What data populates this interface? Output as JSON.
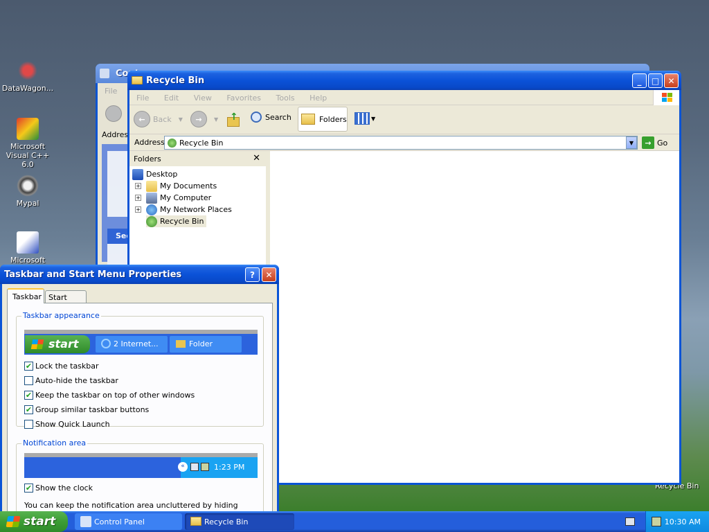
{
  "desktop": {
    "icons": [
      {
        "label": "DataWagon..."
      },
      {
        "label": "Microsoft Visual C++ 6.0"
      },
      {
        "label": "Mypal"
      },
      {
        "label": "Microsoft Visual"
      }
    ],
    "recycle_bin_label": "Recycle Bin"
  },
  "control_panel_window": {
    "title": "Cont",
    "menu_first": "File",
    "address_label": "Address",
    "section_label": "See"
  },
  "recycle_window": {
    "title": "Recycle Bin",
    "menu": [
      "File",
      "Edit",
      "View",
      "Favorites",
      "Tools",
      "Help"
    ],
    "toolbar": {
      "back": "Back",
      "search": "Search",
      "folders": "Folders"
    },
    "address_label": "Address",
    "address_value": "Recycle Bin",
    "go_label": "Go",
    "folders_pane_title": "Folders",
    "tree": [
      {
        "label": "Desktop"
      },
      {
        "label": "My Documents"
      },
      {
        "label": "My Computer"
      },
      {
        "label": "My Network Places"
      },
      {
        "label": "Recycle Bin"
      }
    ]
  },
  "taskbar_dialog": {
    "title": "Taskbar and Start Menu Properties",
    "help_btn": "?",
    "tabs": [
      "Taskbar",
      "Start Menu"
    ],
    "appearance_label": "Taskbar appearance",
    "preview": {
      "start": "start",
      "ie_item": "2 Internet...",
      "folder_item": "Folder"
    },
    "options": [
      {
        "label": "Lock the taskbar",
        "checked": true
      },
      {
        "label": "Auto-hide the taskbar",
        "checked": false
      },
      {
        "label": "Keep the taskbar on top of other windows",
        "checked": true
      },
      {
        "label": "Group similar taskbar buttons",
        "checked": true
      },
      {
        "label": "Show Quick Launch",
        "checked": false
      }
    ],
    "notification_label": "Notification area",
    "notification_time": "1:23 PM",
    "show_clock": {
      "label": "Show the clock",
      "checked": true
    },
    "footer_text": "You can keep the notification area uncluttered by hiding icons that you have not clicked recently."
  },
  "taskbar": {
    "start_label": "start",
    "items": [
      {
        "label": "Control Panel"
      },
      {
        "label": "Recycle Bin"
      }
    ],
    "clock": "10:30 AM"
  },
  "colors": {
    "xp_blue": "#0a54d6",
    "start_green": "#3c9d34",
    "dialog_face": "#ece9d8",
    "group_label": "#0046d5"
  }
}
